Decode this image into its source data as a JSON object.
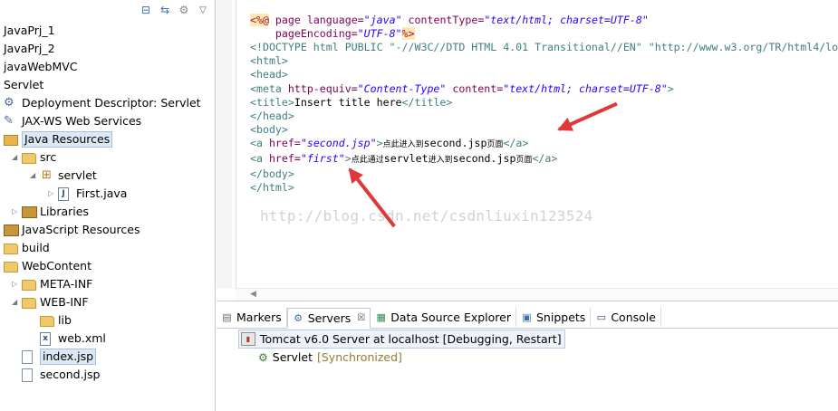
{
  "explorer": {
    "items": [
      {
        "label": "JavaPrj_1",
        "icon": "project-icon",
        "indent": 0,
        "twisty": ""
      },
      {
        "label": "JavaPrj_2",
        "icon": "project-icon",
        "indent": 0,
        "twisty": ""
      },
      {
        "label": "javaWebMVC",
        "icon": "project-icon",
        "indent": 0,
        "twisty": ""
      },
      {
        "label": "Servlet",
        "icon": "project-icon",
        "indent": 0,
        "twisty": ""
      },
      {
        "label": "Deployment Descriptor: Servlet",
        "icon": "deployment-descriptor-icon",
        "indent": 1,
        "twisty": ""
      },
      {
        "label": "JAX-WS Web Services",
        "icon": "web-services-icon",
        "indent": 1,
        "twisty": ""
      },
      {
        "label": "Java Resources",
        "icon": "java-resources-icon",
        "indent": 1,
        "twisty": "",
        "selected": true
      },
      {
        "label": "src",
        "icon": "source-folder-icon",
        "indent": 2,
        "twisty": "▲"
      },
      {
        "label": "servlet",
        "icon": "package-icon",
        "indent": 3,
        "twisty": "▲"
      },
      {
        "label": "First.java",
        "icon": "java-file-icon",
        "indent": 4,
        "twisty": "▷"
      },
      {
        "label": "Libraries",
        "icon": "libraries-icon",
        "indent": 2,
        "twisty": "▷"
      },
      {
        "label": "JavaScript Resources",
        "icon": "javascript-resources-icon",
        "indent": 1,
        "twisty": ""
      },
      {
        "label": "build",
        "icon": "folder-icon",
        "indent": 1,
        "twisty": ""
      },
      {
        "label": "WebContent",
        "icon": "folder-icon",
        "indent": 1,
        "twisty": ""
      },
      {
        "label": "META-INF",
        "icon": "folder-icon",
        "indent": 2,
        "twisty": "▷"
      },
      {
        "label": "WEB-INF",
        "icon": "folder-icon",
        "indent": 2,
        "twisty": "▲"
      },
      {
        "label": "lib",
        "icon": "folder-icon",
        "indent": 3,
        "twisty": ""
      },
      {
        "label": "web.xml",
        "icon": "xml-file-icon",
        "indent": 3,
        "twisty": ""
      },
      {
        "label": "index.jsp",
        "icon": "jsp-file-icon",
        "indent": 2,
        "twisty": "",
        "selected_file": true
      },
      {
        "label": "second.jsp",
        "icon": "jsp-file-icon",
        "indent": 2,
        "twisty": ""
      }
    ]
  },
  "editor": {
    "lines": {
      "l1a": "<%@",
      "l1b": " page ",
      "l1c": "language=",
      "l1d": "\"java\"",
      "l1e": " contentType=",
      "l1f": "\"text/html; charset=UTF-8\"",
      "l2a": "    pageEncoding=",
      "l2b": "\"UTF-8\"",
      "l2c": "%>",
      "l3": "<!DOCTYPE html PUBLIC \"-//W3C//DTD HTML 4.01 Transitional//EN\" \"http://www.w3.org/TR/html4/lo",
      "l4": "<html>",
      "l5": "<head>",
      "l6a": "<meta ",
      "l6b": "http-equiv=",
      "l6c": "\"Content-Type\"",
      "l6d": " content=",
      "l6e": "\"text/html; charset=UTF-8\"",
      "l6f": ">",
      "l7a": "<title>",
      "l7b": "Insert title here",
      "l7c": "</title>",
      "l8": "</head>",
      "l9": "<body>",
      "l10a": "<a ",
      "l10b": "href=",
      "l10c": "\"second.jsp\"",
      "l10d": ">",
      "l10e": "点此进入到",
      "l10f": "second.jsp",
      "l10g": "页面",
      "l10h": "</a>",
      "l11a": "<a ",
      "l11b": "href=",
      "l11c": "\"first\"",
      "l11d": ">",
      "l11e": "点此通过",
      "l11f": "servlet",
      "l11g": "进入到",
      "l11h": "second.jsp",
      "l11i": "页面",
      "l11j": "</a>",
      "l12": "</body>",
      "l13": "</html>"
    },
    "watermark": "http://blog.csdn.net/csdnliuxin123524"
  },
  "bottom": {
    "tabs": [
      {
        "label": "Markers",
        "icon": "markers-icon",
        "glyph": "▤"
      },
      {
        "label": "Servers",
        "icon": "servers-icon",
        "glyph": "⚙",
        "active": true,
        "close": "☒"
      },
      {
        "label": "Data Source Explorer",
        "icon": "data-source-icon",
        "glyph": "▦"
      },
      {
        "label": "Snippets",
        "icon": "snippets-icon",
        "glyph": "▣"
      },
      {
        "label": "Console",
        "icon": "console-icon",
        "glyph": "▭"
      }
    ],
    "server": "Tomcat v6.0 Server at localhost  [Debugging, Restart]",
    "module": "Servlet",
    "module_state": "[Synchronized]"
  },
  "colors": {
    "arrow": "#e0383a",
    "selection": "#dde8f5"
  }
}
